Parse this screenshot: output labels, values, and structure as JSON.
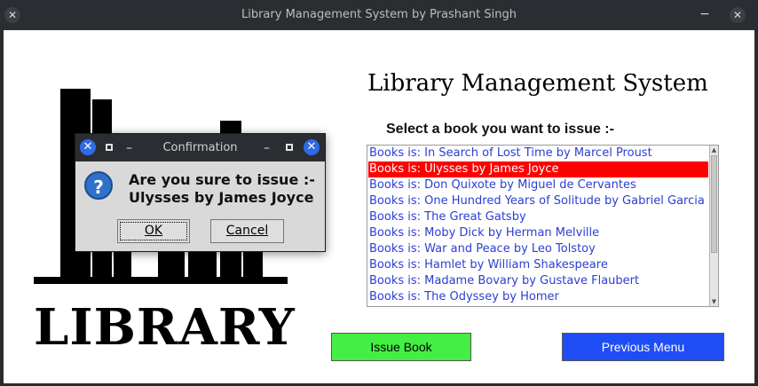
{
  "window": {
    "title": "Library Management System by Prashant Singh"
  },
  "app": {
    "heading": "Library Management System",
    "logo_text": "LIBRARY",
    "select_label": "Select a book you want to issue :-"
  },
  "books": {
    "items": [
      "Books is: In Search of Lost Time by Marcel Proust",
      "Books is: Ulysses by James Joyce",
      "Books is: Don Quixote by Miguel de Cervantes",
      "Books is: One Hundred Years of Solitude by Gabriel Garcia",
      "Books is: The Great Gatsby",
      "Books is: Moby Dick by Herman Melville",
      "Books is: War and Peace by Leo Tolstoy",
      "Books is: Hamlet by William Shakespeare",
      "Books is: Madame Bovary by Gustave Flaubert",
      "Books is: The Odyssey by Homer"
    ],
    "selected_index": 1
  },
  "buttons": {
    "issue": "Issue Book",
    "previous": "Previous Menu"
  },
  "dialog": {
    "title": "Confirmation",
    "message_line1": "Are you sure to issue :-",
    "message_line2": "Ulysses by James Joyce",
    "ok_label": "OK",
    "cancel_label": "Cancel"
  },
  "colors": {
    "issue_button": "#44ee44",
    "previous_button": "#1f4df5",
    "selected_row": "#ff0000",
    "list_text": "#2a3fd0"
  }
}
